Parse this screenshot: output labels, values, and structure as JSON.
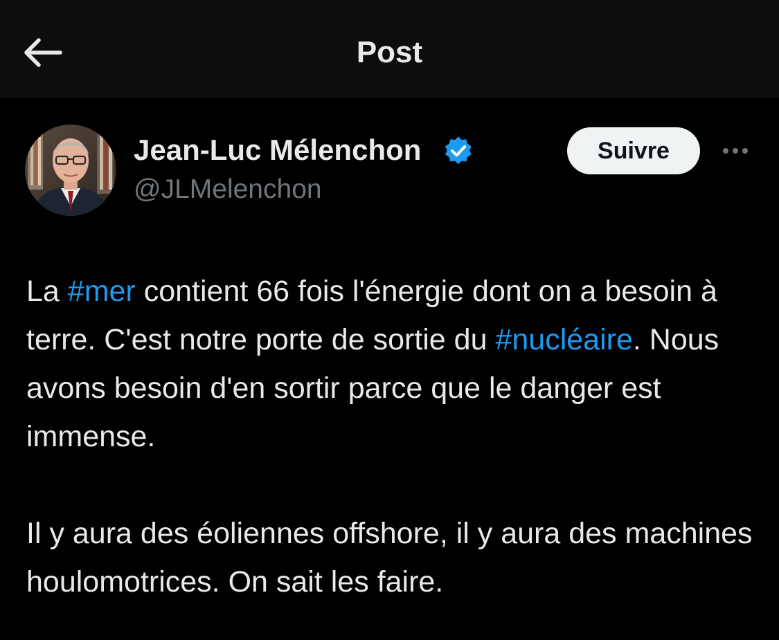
{
  "header": {
    "title": "Post",
    "back_icon": "arrow-left-icon"
  },
  "post": {
    "author": {
      "name": "Jean-Luc Mélenchon",
      "handle": "@JLMelenchon",
      "verified": true,
      "verified_icon": "verified-badge-icon"
    },
    "follow_label": "Suivre",
    "more_icon": "more-options-icon",
    "paragraph1": {
      "t1": "La ",
      "tag1": "#mer",
      "t2": " contient 66 fois l'énergie dont on a besoin à terre. C'est notre porte de sortie du ",
      "tag2": "#nucléaire",
      "t3": ". Nous avons besoin d'en sortir parce que le danger est immense."
    },
    "paragraph2": "Il y aura des éoliennes offshore, il y aura des machines houlomotrices. On sait les faire."
  },
  "colors": {
    "background": "#000000",
    "header_background": "#0d0d0d",
    "text": "#e7e9ea",
    "secondary_text": "#71767b",
    "link": "#1d9bf0",
    "follow_button_bg": "#eff3f4",
    "verified_badge": "#1d9bf0"
  }
}
